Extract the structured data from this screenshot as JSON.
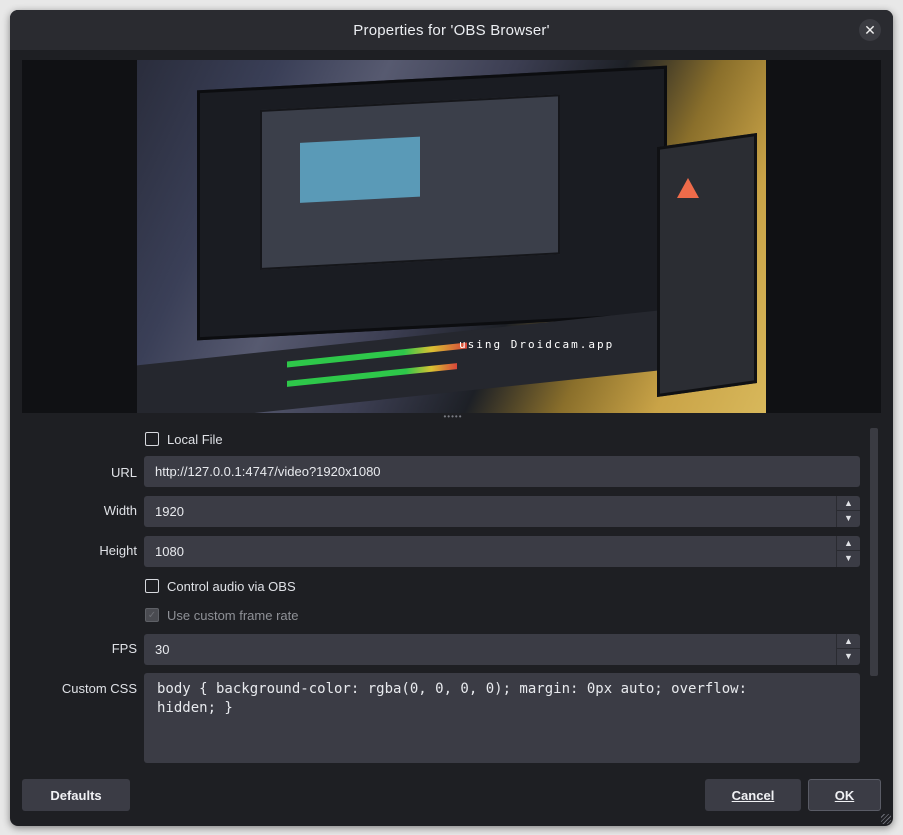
{
  "window": {
    "title": "Properties for 'OBS Browser'",
    "close_icon": "close-icon"
  },
  "preview": {
    "watermark": "using Droidcam.app",
    "splitter_glyph": "•••••"
  },
  "form": {
    "local_file_label": "Local File",
    "local_file_checked": false,
    "url_label": "URL",
    "url_value": "http://127.0.0.1:4747/video?1920x1080",
    "width_label": "Width",
    "width_value": "1920",
    "height_label": "Height",
    "height_value": "1080",
    "control_audio_label": "Control audio via OBS",
    "control_audio_checked": false,
    "custom_frame_rate_label": "Use custom frame rate",
    "custom_frame_rate_checked": true,
    "custom_frame_rate_disabled": true,
    "fps_label": "FPS",
    "fps_value": "30",
    "custom_css_label": "Custom CSS",
    "custom_css_value": "body { background-color: rgba(0, 0, 0, 0); margin: 0px auto; overflow:\nhidden; }",
    "spin_up_icon": "chevron-up-icon",
    "spin_down_icon": "chevron-down-icon"
  },
  "buttons": {
    "defaults": "Defaults",
    "cancel": "Cancel",
    "ok": "OK"
  },
  "colors": {
    "window_bg": "#1e1f23",
    "titlebar_bg": "#2a2b30",
    "field_bg": "#3b3c45",
    "text": "#dfe1e6"
  }
}
